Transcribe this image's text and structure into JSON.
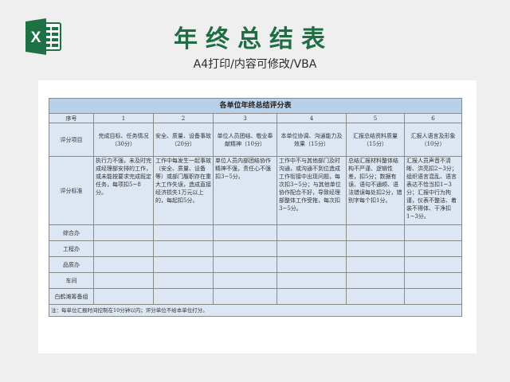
{
  "header": {
    "title": "年终总结表",
    "subtitle": "A4打印/内容可修改/VBA",
    "logo_letter": "X"
  },
  "colors": {
    "brand_green": "#1f6e43",
    "header_blue": "#b9d0ea",
    "cell_blue": "#dde7f3"
  },
  "table": {
    "title": "各单位年终总结评分表",
    "number_row_label": "序号",
    "numbers": [
      "1",
      "2",
      "3",
      "4",
      "5",
      "6"
    ],
    "item_row_label": "评分项目",
    "items": [
      "完成目标、任务情况（30分）",
      "安全、质量、设备事故（20分）",
      "单位人员团结、敬业奉献精神（10分）",
      "本单位协调、沟通能力及效果（15分）",
      "汇报总结资料质量（15分）",
      "汇报人语言及形象（10分）"
    ],
    "standard_row_label": "评分标准",
    "standards": [
      "执行力不强，未及时完成经理部安排的工作，或未能按要求完成既定任务，每项扣5~8分。",
      "工作中每发生一起事故（安全、质量、设备等）或部门履职存在重大工作失误，造成直接经济损失1万元以上的，每起扣5分。",
      "单位人员内部团结协作精神不强，责任心不强扣3~5分。",
      "工作中不与其他部门及时沟通，或沟通不到位造成工作衔接中出现问题，每次扣3~5分；与其他单位协作配合不好，导致经理部整体工作受拖，每次扣3~5分。",
      "总结汇报材料整体结构不严谨、逻辑性差，扣5分；数据有误、语句不通顺、语法错误每处扣2分，错别字每个扣1分。",
      "汇报人员声音不清晰、洪亮扣2~3分；组织语言混乱、语言表达不恰当扣1~3分；汇报中行为拘谨，仪表不整洁、着装不得体、干净扣1~3分。"
    ],
    "departments": [
      "综合办",
      "工程办",
      "品质办",
      "车间",
      "白鹤滩筹备组"
    ],
    "note": "注：每单位汇报时间控制在10分钟以内；评分单位不给本单位打分。"
  }
}
